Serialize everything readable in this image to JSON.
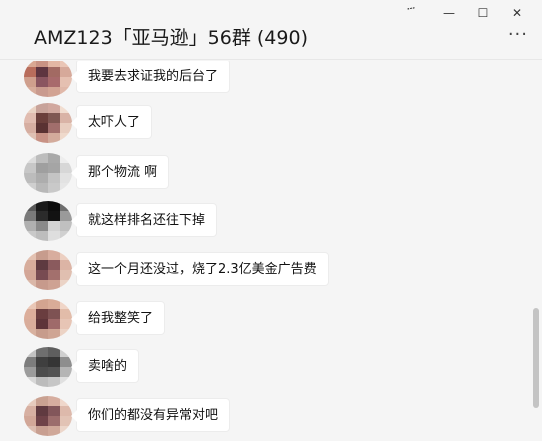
{
  "window": {
    "pin_label": "፝",
    "minimize_label": "—",
    "maximize_label": "☐",
    "close_label": "✕"
  },
  "header": {
    "title": "AMZ123「亚马逊」56群 (490)",
    "more_label": "···"
  },
  "messages": [
    {
      "text": "我要去求证我的后台了",
      "avatar_palette": [
        "#d9a893",
        "#c99384",
        "#e3b7a4",
        "#eac6b6",
        "#b86d5c",
        "#5e3540",
        "#a26a63",
        "#d6a99a",
        "#cf9f8d",
        "#8a5560",
        "#a86a6c",
        "#e5c0b1",
        "#d7ac9b",
        "#c99a8e",
        "#d2a393",
        "#e0b8a9"
      ]
    },
    {
      "text": "太吓人了",
      "avatar_palette": [
        "#ead2c3",
        "#c8a39a",
        "#d1a89f",
        "#f1ddd0",
        "#e1bcb0",
        "#6b3f3b",
        "#7f5752",
        "#d9b3a6",
        "#d6aea1",
        "#5a3232",
        "#a16e6c",
        "#e8cdbf",
        "#dfc0b3",
        "#c89285",
        "#d3ab9c",
        "#efd9cb"
      ]
    },
    {
      "text": "那个物流 啊",
      "avatar_palette": [
        "#dcdcdc",
        "#bdbdbd",
        "#a9a9a9",
        "#ededed",
        "#c7c7c7",
        "#9f9f9f",
        "#a5a5a5",
        "#d7d7d7",
        "#bcbcbc",
        "#adadad",
        "#c4c4c4",
        "#e2e2e2",
        "#cfcfcf",
        "#b8b8b8",
        "#c9c9c9",
        "#e6e6e6"
      ]
    },
    {
      "text": "就这样排名还往下掉",
      "avatar_palette": [
        "#5a5a5a",
        "#1a1a1a",
        "#0d0d0d",
        "#6e6e6e",
        "#7a7a7a",
        "#2b2b2b",
        "#121212",
        "#9a9a9a",
        "#b0b0b0",
        "#8a8a8a",
        "#d3d3d3",
        "#c0c0c0",
        "#c9c9c9",
        "#bdbdbd",
        "#dedede",
        "#d0d0d0"
      ]
    },
    {
      "text": "这一个月还没过，烧了2.3亿美金广告费",
      "avatar_palette": [
        "#e3c1b1",
        "#c79c8d",
        "#d8ad9e",
        "#eccfc1",
        "#d7ad9c",
        "#5e3a40",
        "#8a5a5d",
        "#dcb4a5",
        "#d3a697",
        "#784b52",
        "#a3706d",
        "#e0bfb0",
        "#dab7a8",
        "#c79a8c",
        "#cea293",
        "#ebd3c6"
      ]
    },
    {
      "text": "给我整笑了",
      "avatar_palette": [
        "#eac7b6",
        "#d3a490",
        "#d9ac98",
        "#f0d5c7",
        "#dcae9b",
        "#6a3d3f",
        "#7e5253",
        "#e2bca9",
        "#d9ad9b",
        "#5e3439",
        "#9f6a6a",
        "#e7c5b5",
        "#d8b19f",
        "#c79c8c",
        "#cfa594",
        "#ecd3c5"
      ]
    },
    {
      "text": "卖啥的",
      "avatar_palette": [
        "#c2c2c2",
        "#6f6f6f",
        "#5e5e5e",
        "#cfcfcf",
        "#7d7d7d",
        "#3f3f3f",
        "#353535",
        "#8e8e8e",
        "#9c9c9c",
        "#4c4c4c",
        "#525252",
        "#b5b5b5",
        "#d7d7d7",
        "#bcbcbc",
        "#c6c6c6",
        "#e0e0e0"
      ]
    },
    {
      "text": "你们的都没有异常对吧",
      "avatar_palette": [
        "#e6cbbd",
        "#c9a191",
        "#d6ad9f",
        "#efd7cb",
        "#d7b0a2",
        "#603a40",
        "#82565a",
        "#ddb9ab",
        "#d2a798",
        "#6f4248",
        "#9c6d6c",
        "#e2c3b5",
        "#dcbcaf",
        "#c89f91",
        "#d0a899",
        "#ecd6ca"
      ]
    }
  ]
}
